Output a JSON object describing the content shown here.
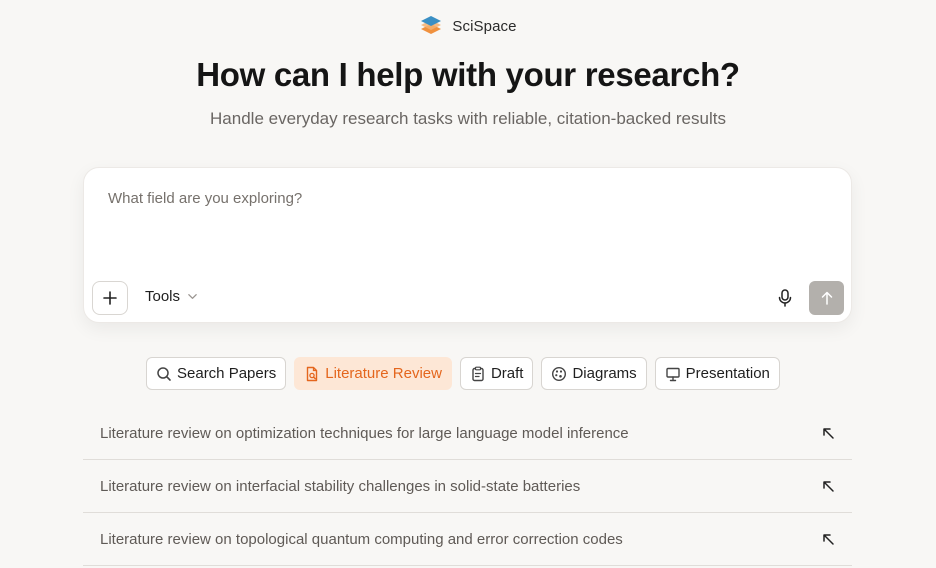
{
  "brand": {
    "name": "SciSpace"
  },
  "hero": {
    "title": "How can I help with your research?",
    "subtitle": "Handle everyday research tasks with reliable, citation-backed results"
  },
  "composer": {
    "placeholder": "What field are you exploring?",
    "tools_label": "Tools"
  },
  "chips": [
    {
      "label": "Search Papers",
      "icon": "search-icon",
      "active": false
    },
    {
      "label": "Literature Review",
      "icon": "document-icon",
      "active": true
    },
    {
      "label": "Draft",
      "icon": "clipboard-icon",
      "active": false
    },
    {
      "label": "Diagrams",
      "icon": "palette-icon",
      "active": false
    },
    {
      "label": "Presentation",
      "icon": "presentation-icon",
      "active": false
    }
  ],
  "suggestions": [
    {
      "text": "Literature review on optimization techniques for large language model inference"
    },
    {
      "text": "Literature review on interfacial stability challenges in solid-state batteries"
    },
    {
      "text": "Literature review on topological quantum computing and error correction codes"
    }
  ],
  "colors": {
    "accent": "#e4661d",
    "accent_bg": "#fde7d6",
    "background": "#f8f7f5",
    "send_disabled": "#b3b0ac"
  }
}
